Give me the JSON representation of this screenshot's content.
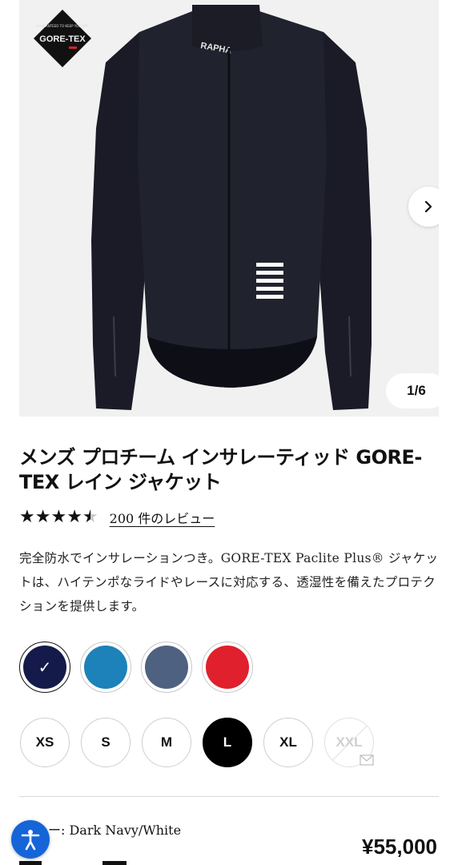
{
  "gallery": {
    "counter": "1/6",
    "badge_text": "GORE-TEX",
    "badge_small_text": "GUARANTEED TO KEEP YOU DRY",
    "collar_logo": "RAPHA",
    "next_icon": "chevron-right-icon"
  },
  "product": {
    "title": "メンズ プロチーム インサレーティッド GORE-TEX レイン ジャケット",
    "rating": 4.5,
    "rating_max": 5,
    "reviews_link": "200 件のレビュー",
    "description": "完全防水でインサレーションつき。GORE-TEX Paclite Plus® ジャケットは、ハイテンポなライドやレースに対応する、透湿性を備えたプロテクションを提供します。"
  },
  "colors": [
    {
      "name": "Dark Navy/White",
      "hex": "#141a4a",
      "selected": true
    },
    {
      "name": "blue",
      "hex": "#1c82b9",
      "selected": false
    },
    {
      "name": "slate",
      "hex": "#4f6180",
      "selected": false
    },
    {
      "name": "red",
      "hex": "#e0202c",
      "selected": false
    }
  ],
  "sizes": [
    {
      "label": "XS",
      "selected": false,
      "available": true
    },
    {
      "label": "S",
      "selected": false,
      "available": true
    },
    {
      "label": "M",
      "selected": false,
      "available": true
    },
    {
      "label": "L",
      "selected": true,
      "available": true
    },
    {
      "label": "XL",
      "selected": false,
      "available": true
    },
    {
      "label": "XXL",
      "selected": false,
      "available": false
    }
  ],
  "selection": {
    "color_label": "ー: Dark Navy/White",
    "price": "¥55,000"
  }
}
